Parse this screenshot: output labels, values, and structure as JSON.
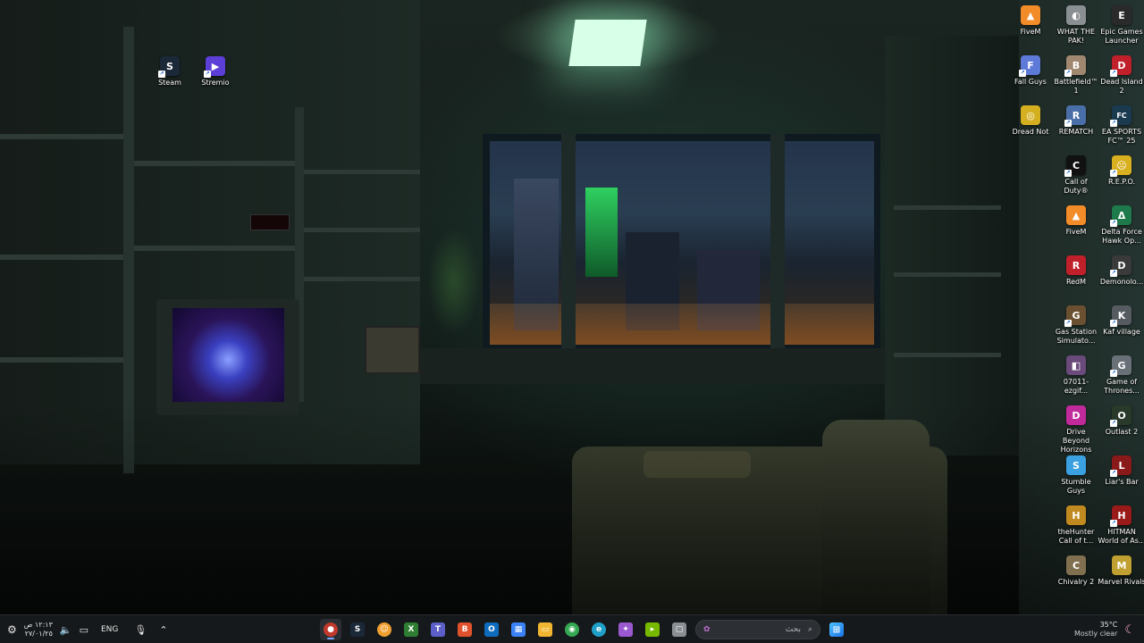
{
  "taskbar": {
    "language": "ENG",
    "clock": {
      "time": "١٢:١٣ ص",
      "date": "٢٧/٠١/٢٥"
    },
    "search": {
      "placeholder": "بحث"
    },
    "apps": [
      {
        "name": "obs-icon",
        "glyph": "●",
        "color": "#c0392b",
        "active": true
      },
      {
        "name": "steam-icon",
        "glyph": "S",
        "color": "#1b2838",
        "active": false
      },
      {
        "name": "chat-icon",
        "glyph": "☺",
        "color": "#f0a030",
        "active": false
      },
      {
        "name": "xbox-icon",
        "glyph": "X",
        "color": "#2e7d32",
        "active": false
      },
      {
        "name": "teams-icon",
        "glyph": "T",
        "color": "#5b5fc7",
        "active": false
      },
      {
        "name": "brave-icon",
        "glyph": "B",
        "color": "#e0522d",
        "active": false
      },
      {
        "name": "outlook-icon",
        "glyph": "O",
        "color": "#0f6cbd",
        "active": false
      },
      {
        "name": "store-icon",
        "glyph": "▦",
        "color": "#3b82f6",
        "active": false
      },
      {
        "name": "explorer-icon",
        "glyph": "▭",
        "color": "#f2b632",
        "active": false
      },
      {
        "name": "chrome-icon",
        "glyph": "◉",
        "color": "#34a853",
        "active": false
      },
      {
        "name": "edge-icon",
        "glyph": "e",
        "color": "#1fa0c8",
        "active": false
      },
      {
        "name": "copilot-icon",
        "glyph": "✦",
        "color": "#9b59d0",
        "active": false
      },
      {
        "name": "nvidia-icon",
        "glyph": "▸",
        "color": "#76b900",
        "active": false
      },
      {
        "name": "window-icon",
        "glyph": "▢",
        "color": "#8a8f94",
        "active": false
      }
    ],
    "weather": {
      "temperature": "35°C",
      "condition": "Mostly clear"
    }
  },
  "desktop_icons": [
    {
      "label": "Steam",
      "glyph": "S",
      "color": "#1b2838"
    },
    {
      "label": "Stremio",
      "glyph": "▶",
      "color": "#5b3fd6"
    },
    {
      "label": "FiveM",
      "glyph": "▲",
      "color": "#f28c28"
    },
    {
      "label": "WHAT THE PAK!",
      "glyph": "◐",
      "color": "#8a8f94"
    },
    {
      "label": "Epic Games Launcher",
      "glyph": "E",
      "color": "#2a2a2a"
    },
    {
      "label": "Fall Guys",
      "glyph": "F",
      "color": "#5e7ad8"
    },
    {
      "label": "Battlefield™ 1",
      "glyph": "B",
      "color": "#a08870"
    },
    {
      "label": "Dead Island 2",
      "glyph": "D",
      "color": "#c0202a"
    },
    {
      "label": "Dread Not",
      "glyph": "◎",
      "color": "#d4b020"
    },
    {
      "label": "REMATCH",
      "glyph": "R",
      "color": "#4a6fa8"
    },
    {
      "label": "EA SPORTS FC™ 25",
      "glyph": "FC",
      "color": "#1a3a50"
    },
    {
      "label": "Call of Duty®",
      "glyph": "C",
      "color": "#111111"
    },
    {
      "label": "R.E.P.O.",
      "glyph": "☹",
      "color": "#d8b020"
    },
    {
      "label": "FiveM",
      "glyph": "▲",
      "color": "#f28c28"
    },
    {
      "label": "Delta Force Hawk Op...",
      "glyph": "Δ",
      "color": "#1e7a4a"
    },
    {
      "label": "RedM",
      "glyph": "R",
      "color": "#c0202a"
    },
    {
      "label": "Demonolo...",
      "glyph": "D",
      "color": "#3a3a3a"
    },
    {
      "label": "Gas Station Simulato...",
      "glyph": "G",
      "color": "#6a5030"
    },
    {
      "label": "Kaf village",
      "glyph": "K",
      "color": "#555b60"
    },
    {
      "label": "07011-ezgif...",
      "glyph": "◧",
      "color": "#6a4a7a"
    },
    {
      "label": "Game of Thrones...",
      "glyph": "G",
      "color": "#6a7078"
    },
    {
      "label": "Drive Beyond Horizons",
      "glyph": "D",
      "color": "#c02a9a"
    },
    {
      "label": "Outlast 2",
      "glyph": "O",
      "color": "#2a3a2a"
    },
    {
      "label": "Stumble Guys",
      "glyph": "S",
      "color": "#3aa0e0"
    },
    {
      "label": "Liar's Bar",
      "glyph": "L",
      "color": "#8a1a1a"
    },
    {
      "label": "theHunter Call of t...",
      "glyph": "H",
      "color": "#c08a20"
    },
    {
      "label": "HITMAN World of As...",
      "glyph": "H",
      "color": "#9a1a1a"
    },
    {
      "label": "Chivalry 2",
      "glyph": "C",
      "color": "#807050"
    },
    {
      "label": "Marvel Rivals",
      "glyph": "M",
      "color": "#c0a030"
    }
  ]
}
